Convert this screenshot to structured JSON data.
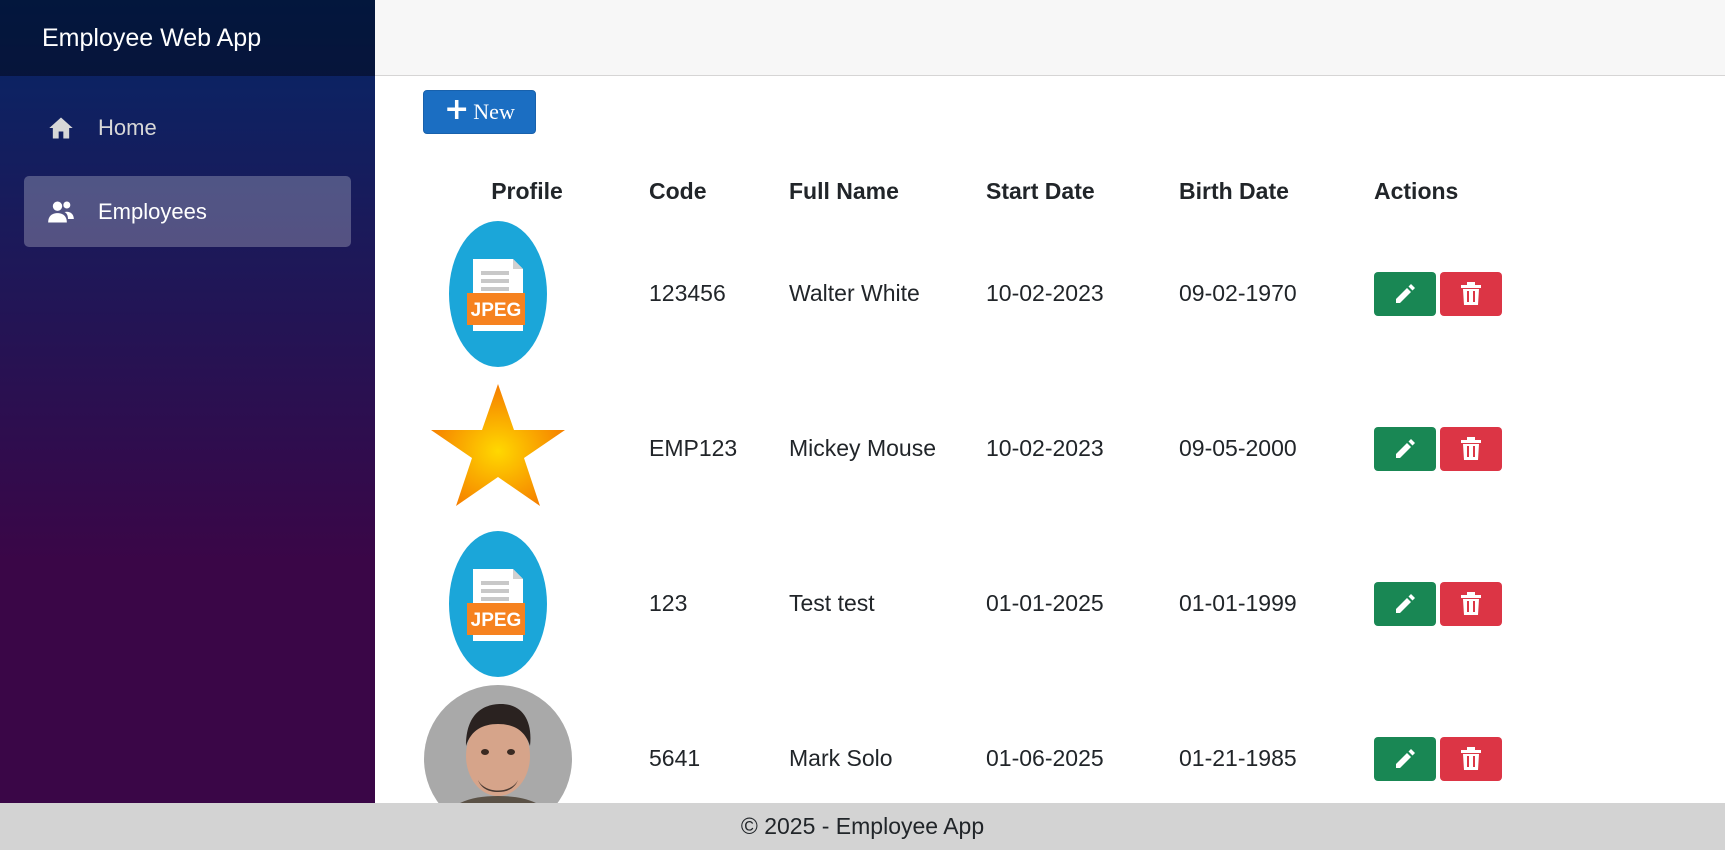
{
  "app": {
    "title": "Employee Web App"
  },
  "sidebar": {
    "items": [
      {
        "label": "Home",
        "icon": "home-icon",
        "active": false
      },
      {
        "label": "Employees",
        "icon": "people-icon",
        "active": true
      }
    ]
  },
  "toolbar": {
    "new_label": "New",
    "new_icon": "plus-icon"
  },
  "table": {
    "headers": [
      "Profile",
      "Code",
      "Full Name",
      "Start Date",
      "Birth Date",
      "Actions"
    ],
    "rows": [
      {
        "profile": "jpeg-file-icon",
        "code": "123456",
        "name": "Walter White",
        "start": "10-02-2023",
        "birth": "09-02-1970"
      },
      {
        "profile": "star-image",
        "code": "EMP123",
        "name": "Mickey Mouse",
        "start": "10-02-2023",
        "birth": "09-05-2000"
      },
      {
        "profile": "jpeg-file-icon",
        "code": "123",
        "name": "Test test",
        "start": "01-01-2025",
        "birth": "01-01-1999"
      },
      {
        "profile": "person-photo",
        "code": "5641",
        "name": "Mark Solo",
        "start": "01-06-2025",
        "birth": "01-21-1985"
      }
    ]
  },
  "footer": {
    "text": "© 2025 - Employee App"
  },
  "colors": {
    "primary": "#1b6ec2",
    "edit": "#198754",
    "delete": "#dc3545"
  }
}
